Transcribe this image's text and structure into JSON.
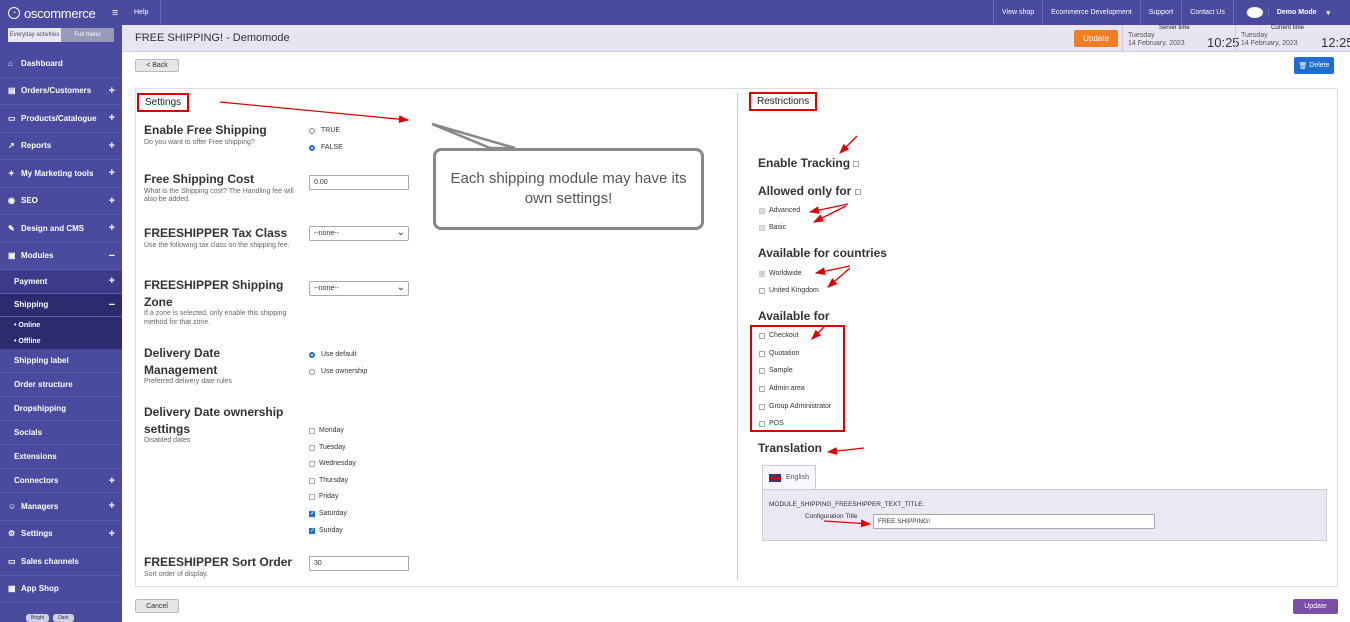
{
  "sidebar": {
    "brand": "oscommerce",
    "seg": {
      "a": "Everyday activities",
      "b": "Full menu"
    },
    "items": [
      {
        "label": "Dashboard",
        "icon": "dashboard-icon"
      },
      {
        "label": "Orders/Customers",
        "icon": "cart-icon",
        "pm": "+"
      },
      {
        "label": "Products/Catalogue",
        "icon": "folder-icon",
        "pm": "+"
      },
      {
        "label": "Reports",
        "icon": "chart-icon",
        "pm": "+"
      },
      {
        "label": "My Marketing tools",
        "icon": "megaphone-icon",
        "pm": "+"
      },
      {
        "label": "SEO",
        "icon": "globe-icon",
        "pm": "+"
      },
      {
        "label": "Design and CMS",
        "icon": "brush-icon",
        "pm": "+"
      },
      {
        "label": "Modules",
        "icon": "puzzle-icon",
        "pm": "−"
      }
    ],
    "sub": [
      {
        "label": "Payment",
        "pm": "+"
      },
      {
        "label": "Shipping",
        "pm": "−"
      }
    ],
    "subsub": [
      "Online",
      "Offline"
    ],
    "plain": [
      {
        "label": "Shipping label"
      },
      {
        "label": "Order structure"
      },
      {
        "label": "Dropshipping"
      },
      {
        "label": "Socials"
      },
      {
        "label": "Extensions"
      },
      {
        "label": "Connectors",
        "pm": "+"
      }
    ],
    "bottom": [
      {
        "label": "Managers",
        "icon": "user-icon",
        "pm": "+"
      },
      {
        "label": "Settings",
        "icon": "gear-icon",
        "pm": "+"
      },
      {
        "label": "Sales channels",
        "icon": "monitor-icon"
      },
      {
        "label": "App Shop",
        "icon": "shop-icon"
      }
    ],
    "themes": [
      "Bright",
      "Dark"
    ]
  },
  "topbar": {
    "help": "Help",
    "links": [
      "View shop",
      "Ecommerce Development",
      "Support",
      "Contact Us",
      "Demo Mode"
    ]
  },
  "title": "FREE SHIPPING! - Demomode",
  "update_top": "Update",
  "server_time": {
    "label": "Server time",
    "day": "Tuesday",
    "date": "14 February, 2023",
    "clock": "10:25"
  },
  "current_time": {
    "label": "Current time",
    "day": "Tuesday",
    "date": "14 February, 2023",
    "clock": "12:25"
  },
  "back": "< Back",
  "delete": "Delete",
  "settings": {
    "header": "Settings",
    "enable": {
      "h": "Enable Free Shipping",
      "s": "Do you want to offer Free shipping?",
      "opts": [
        "TRUE",
        "FALSE"
      ]
    },
    "cost": {
      "h": "Free Shipping Cost",
      "s": "What is the Shipping cost? The Handling fee will also be added.",
      "value": "0.00"
    },
    "tax": {
      "h": "FREESHIPPER Tax Class",
      "s": "Use the following tax class on the shipping fee.",
      "value": "--none--"
    },
    "zone": {
      "h": "FREESHIPPER Shipping Zone",
      "s": "If a zone is selected, only enable this shipping method for that zone.",
      "value": "--none--"
    },
    "ddm": {
      "h": "Delivery Date Management",
      "s": "Preferred delivery date rules",
      "opts": [
        "Use default",
        "Use ownership"
      ]
    },
    "ddo": {
      "h": "Delivery Date ownership settings",
      "s": "Disabled dates",
      "days": [
        "Monday",
        "Tuesday",
        "Wednesday",
        "Thursday",
        "Friday",
        "Saturday",
        "Sunday"
      ]
    },
    "sort": {
      "h": "FREESHIPPER Sort Order",
      "s": "Sort order of display.",
      "value": "30"
    }
  },
  "bubble": "Each shipping module may have its own settings!",
  "restrictions": {
    "header": "Restrictions",
    "tracking": "Enable Tracking",
    "allowed": "Allowed only for",
    "allowed_opts": [
      "Advanced",
      "Basic"
    ],
    "countries": "Available for countries",
    "country_opts": [
      "Worldwide",
      "United Kingdom"
    ],
    "available": "Available for",
    "available_opts": [
      "Checkout",
      "Quotation",
      "Sample",
      "Admin area",
      "Group Administrator",
      "POS"
    ],
    "translation": "Translation",
    "lang": "English",
    "key": "MODULE_SHIPPING_FREESHIPPER_TEXT_TITLE:",
    "config_label": "Configuration Title",
    "config_value": "FREE SHIPPING!"
  },
  "cancel": "Cancel",
  "update_bottom": "Update",
  "colors": {
    "sidebar": "#4a4a9e",
    "orange": "#ee7d24",
    "blue": "#1e6fd0",
    "purple": "#7a4da8",
    "annotation": "#dd0000"
  }
}
